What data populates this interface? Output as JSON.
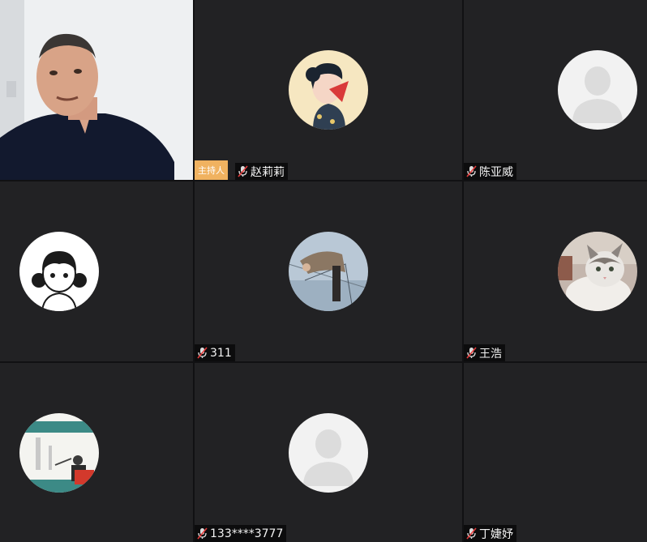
{
  "participants": [
    {
      "name": "",
      "video": true
    },
    {
      "name": "赵莉莉",
      "badge": "主持人"
    },
    {
      "name": "陈亚威"
    },
    {
      "name": ""
    },
    {
      "name": "311"
    },
    {
      "name": "王浩"
    },
    {
      "name": ""
    },
    {
      "name": "133****3777"
    },
    {
      "name": "丁婕妤"
    }
  ],
  "icons": {
    "mic": "muted-mic-icon",
    "default_avatar": "person-silhouette-icon"
  },
  "colors": {
    "tile_bg": "#222224",
    "grid_line": "#111113",
    "host_badge": "#f0b260",
    "name_bg": "#0c0c0d"
  }
}
